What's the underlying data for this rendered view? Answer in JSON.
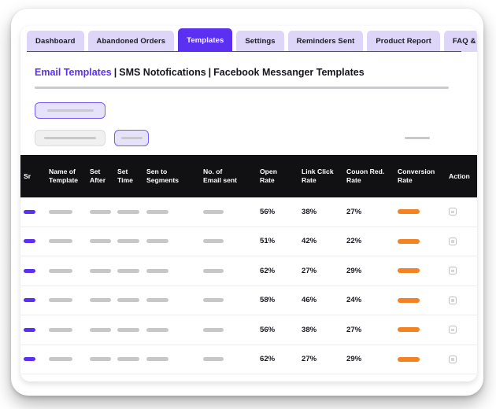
{
  "tabs": [
    {
      "label": "Dashboard",
      "active": false
    },
    {
      "label": "Abandoned Orders",
      "active": false
    },
    {
      "label": "Templates",
      "active": true
    },
    {
      "label": "Settings",
      "active": false
    },
    {
      "label": "Reminders Sent",
      "active": false
    },
    {
      "label": "Product Report",
      "active": false
    },
    {
      "label": "FAQ & SUpport",
      "active": false
    }
  ],
  "title": {
    "part1": "Email Templates",
    "sep1": "|",
    "part2": "SMS Notofications",
    "sep2": "|",
    "part3": "Facebook Messanger Templates"
  },
  "colors": {
    "accent_purple": "#5b30f0",
    "tab_inactive": "#ddd6f8",
    "header_black": "#111114",
    "bar_orange": "#f58220",
    "skeleton_gray": "#c7c7c7"
  },
  "table": {
    "columns": [
      "Sr",
      "Name of\nTemplate",
      "Set\nAfter",
      "Set\nTime",
      "Sen to\nSegments",
      "No. of\nEmail sent",
      "Open\nRate",
      "Link Click\nRate",
      "Couon Red.\nRate",
      "Conversion\nRate",
      "Action"
    ],
    "rows": [
      {
        "open_rate": "56%",
        "link_click_rate": "38%",
        "coupon_red_rate": "27%"
      },
      {
        "open_rate": "51%",
        "link_click_rate": "42%",
        "coupon_red_rate": "22%"
      },
      {
        "open_rate": "62%",
        "link_click_rate": "27%",
        "coupon_red_rate": "29%"
      },
      {
        "open_rate": "58%",
        "link_click_rate": "46%",
        "coupon_red_rate": "24%"
      },
      {
        "open_rate": "56%",
        "link_click_rate": "38%",
        "coupon_red_rate": "27%"
      },
      {
        "open_rate": "62%",
        "link_click_rate": "27%",
        "coupon_red_rate": "29%"
      }
    ]
  }
}
